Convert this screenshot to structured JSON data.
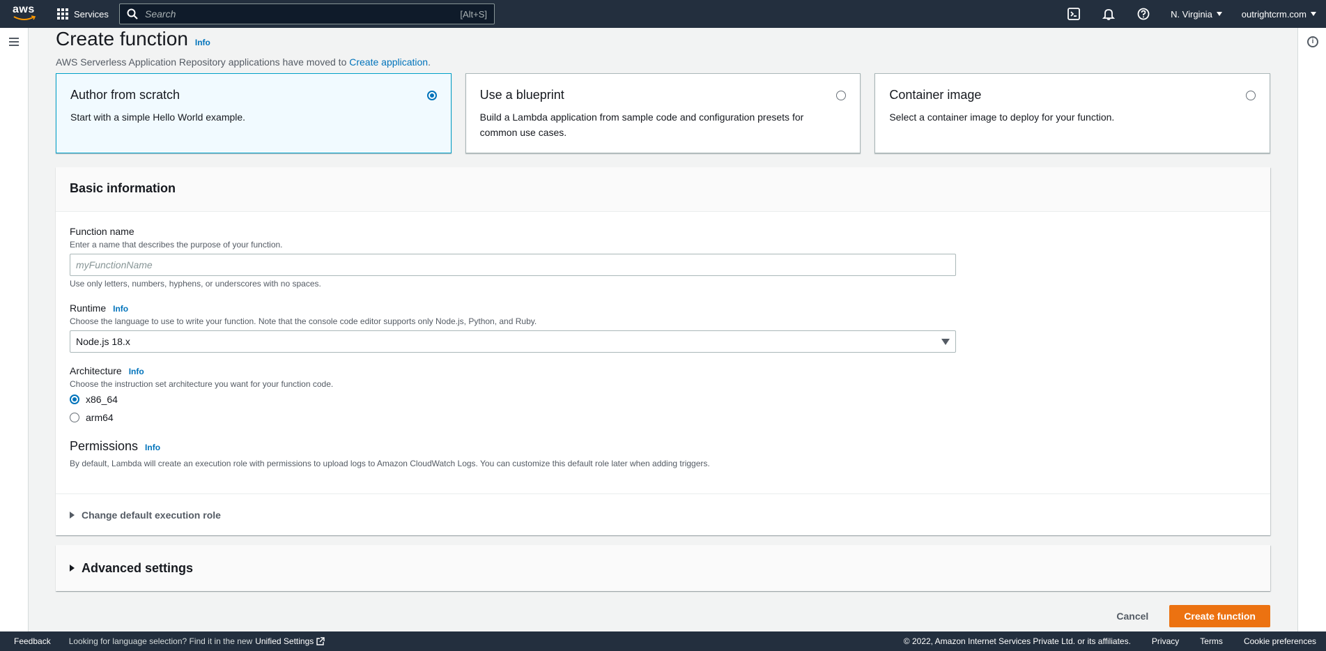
{
  "topnav": {
    "logo_text": "aws",
    "services_label": "Services",
    "search_placeholder": "Search",
    "search_shortcut": "[Alt+S]",
    "region": "N. Virginia",
    "account": "outrightcrm.com",
    "icons": [
      "grid-icon",
      "search-icon",
      "cloudshell-icon",
      "bell-icon",
      "help-icon"
    ]
  },
  "page": {
    "title": "Create function",
    "info": "Info",
    "subtitle_prefix": "AWS Serverless Application Repository applications have moved to ",
    "subtitle_link": "Create application",
    "subtitle_suffix": "."
  },
  "options": [
    {
      "title": "Author from scratch",
      "desc": "Start with a simple Hello World example.",
      "selected": true
    },
    {
      "title": "Use a blueprint",
      "desc": "Build a Lambda application from sample code and configuration presets for common use cases.",
      "selected": false
    },
    {
      "title": "Container image",
      "desc": "Select a container image to deploy for your function.",
      "selected": false
    }
  ],
  "basic": {
    "header": "Basic information",
    "function_name": {
      "label": "Function name",
      "desc": "Enter a name that describes the purpose of your function.",
      "placeholder": "myFunctionName",
      "value": "",
      "constraint": "Use only letters, numbers, hyphens, or underscores with no spaces."
    },
    "runtime": {
      "label": "Runtime",
      "info": "Info",
      "desc": "Choose the language to use to write your function. Note that the console code editor supports only Node.js, Python, and Ruby.",
      "value": "Node.js 18.x"
    },
    "architecture": {
      "label": "Architecture",
      "info": "Info",
      "desc": "Choose the instruction set architecture you want for your function code.",
      "options": [
        "x86_64",
        "arm64"
      ],
      "selected": "x86_64"
    },
    "permissions": {
      "title": "Permissions",
      "info": "Info",
      "desc": "By default, Lambda will create an execution role with permissions to upload logs to Amazon CloudWatch Logs. You can customize this default role later when adding triggers."
    },
    "change_role": "Change default execution role"
  },
  "advanced": "Advanced settings",
  "actions": {
    "cancel": "Cancel",
    "create": "Create function"
  },
  "footer": {
    "feedback": "Feedback",
    "note": "Looking for language selection? Find it in the new",
    "unified": "Unified Settings",
    "copyright": "© 2022, Amazon Internet Services Private Ltd. or its affiliates.",
    "privacy": "Privacy",
    "terms": "Terms",
    "cookies": "Cookie preferences"
  },
  "colors": {
    "nav_bg": "#232f3e",
    "primary": "#ec7211",
    "link": "#0073bb",
    "selected_tile_bg": "#f1faff",
    "selected_tile_border": "#00a1c9"
  }
}
